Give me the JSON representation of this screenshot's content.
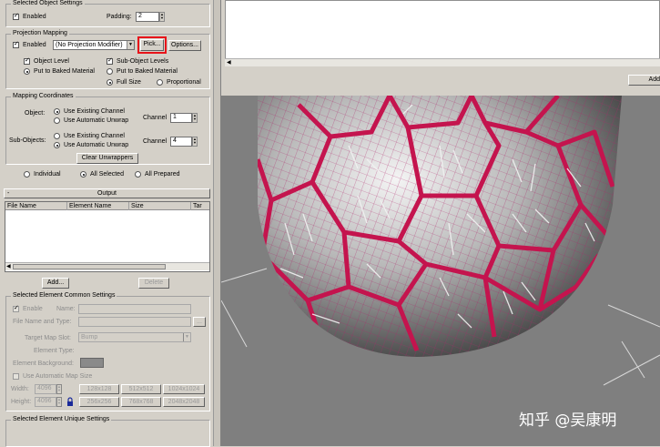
{
  "selected_object_settings": {
    "title": "Selected Object Settings",
    "enabled_label": "Enabled",
    "padding_label": "Padding:",
    "padding_value": "2"
  },
  "projection_mapping": {
    "title": "Projection Mapping",
    "enabled_label": "Enabled",
    "modifier_select": "(No Projection Modifier)",
    "pick_label": "Pick...",
    "options_label": "Options...",
    "object_level": "Object Level",
    "sub_object_levels": "Sub-Object Levels",
    "put_to_baked_1": "Put to Baked Material",
    "put_to_baked_2": "Put to Baked Material",
    "full_size": "Full Size",
    "proportional": "Proportional",
    "highlight_color": "#e8141a"
  },
  "mapping_coordinates": {
    "title": "Mapping Coordinates",
    "object_label": "Object:",
    "use_existing": "Use Existing Channel",
    "use_auto": "Use Automatic Unwrap",
    "channel_label": "Channel",
    "channel_value": "1",
    "sub_objects_label": "Sub-Objects:",
    "sub_use_existing": "Use Existing Channel",
    "sub_use_auto": "Use Automatic Unwrap",
    "sub_channel_label": "Channel",
    "sub_channel_value": "4",
    "clear_unwrappers": "Clear Unwrappers"
  },
  "selection_mode": {
    "individual": "Individual",
    "all_selected": "All Selected",
    "all_prepared": "All Prepared"
  },
  "output": {
    "rollout_title": "Output",
    "toggle": "-",
    "columns": [
      "File Name",
      "Element Name",
      "Size",
      "Tar"
    ],
    "add_label": "Add...",
    "delete_label": "Delete"
  },
  "selected_element_common": {
    "title": "Selected Element Common Settings",
    "enable_label": "Enable",
    "name_label": "Name:",
    "file_name_label": "File Name and Type:",
    "file_name_btn": "...",
    "target_map_slot_label": "Target Map Slot:",
    "target_map_slot_value": "Bump",
    "element_type_label": "Element Type:",
    "element_background_label": "Element Background:",
    "use_auto_map_size": "Use Automatic Map Size",
    "width_label": "Width:",
    "width_value": "4096",
    "height_label": "Height:",
    "height_value": "4096",
    "size_buttons": [
      "128x128",
      "512x512",
      "1024x1024",
      "256x256",
      "768x768",
      "2048x2048"
    ]
  },
  "selected_element_unique": {
    "title": "Selected Element Unique Settings"
  },
  "top_right": {
    "add_label": "Add"
  },
  "watermark": "知乎 @吴康明"
}
